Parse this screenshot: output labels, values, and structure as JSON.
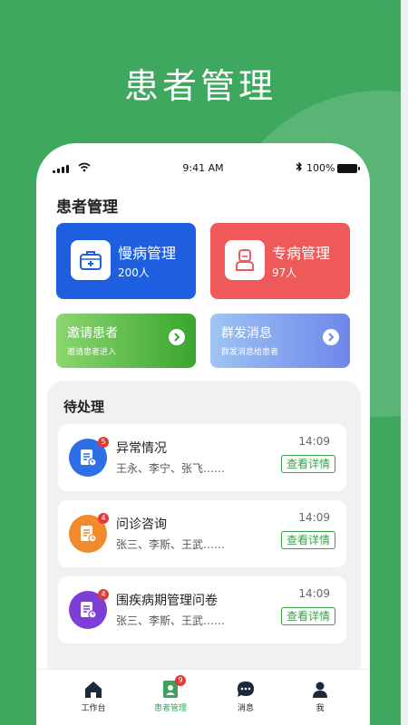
{
  "hero": {
    "title": "患者管理"
  },
  "status_bar": {
    "time": "9:41 AM",
    "battery": "100%"
  },
  "page": {
    "title": "患者管理"
  },
  "cards": {
    "chronic": {
      "title": "慢病管理",
      "count": "200人",
      "color": "#1e5fe0"
    },
    "special": {
      "title": "专病管理",
      "count": "97人",
      "color": "#ee5a5a"
    },
    "invite": {
      "title": "邀请患者",
      "subtitle": "邀请患者进入"
    },
    "broadcast": {
      "title": "群发消息",
      "subtitle": "群发消息给患者"
    }
  },
  "pending": {
    "title": "待处理",
    "items": [
      {
        "title": "异常情况",
        "names": "王永、李宁、张飞……",
        "time": "14:09",
        "badge": "5",
        "action": "查看详情",
        "color": "#2f6fe6",
        "icon": "abnormal-doc-icon"
      },
      {
        "title": "问诊咨询",
        "names": "张三、李斯、王武……",
        "time": "14:09",
        "badge": "4",
        "action": "查看详情",
        "color": "#f08a2a",
        "icon": "consult-doc-icon"
      },
      {
        "title": "围疾病期管理问卷",
        "names": "张三、李斯、王武……",
        "time": "14:09",
        "badge": "4",
        "action": "查看详情",
        "color": "#7b3fd6",
        "icon": "questionnaire-doc-icon"
      }
    ]
  },
  "tabbar": {
    "items": [
      {
        "label": "工作台",
        "icon": "home-icon"
      },
      {
        "label": "患者管理",
        "icon": "patient-icon",
        "badge": "9",
        "active": true
      },
      {
        "label": "消息",
        "icon": "message-icon"
      },
      {
        "label": "我",
        "icon": "user-icon"
      }
    ]
  },
  "colors": {
    "brand_green": "#3ea75f",
    "active_tab": "#3aa15a",
    "badge_red": "#e53935"
  }
}
